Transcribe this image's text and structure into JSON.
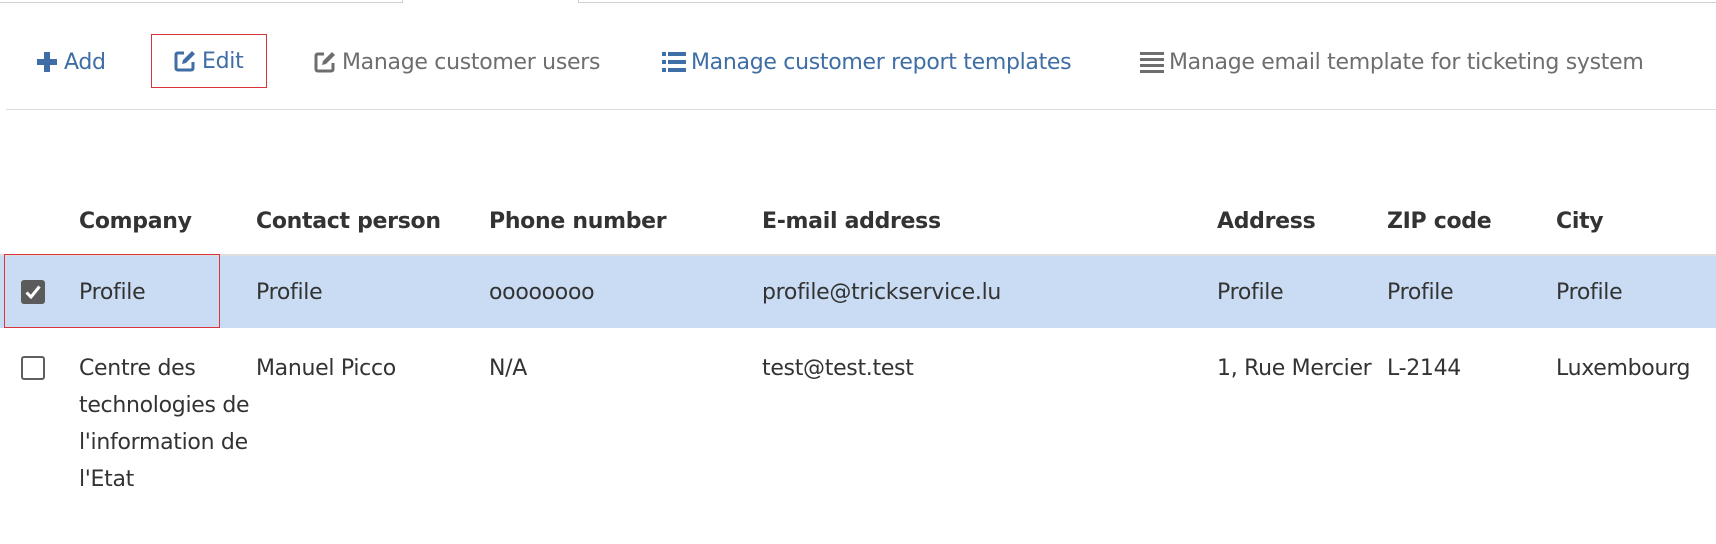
{
  "toolbar": {
    "add": {
      "label": "Add",
      "icon": "plus-icon"
    },
    "edit": {
      "label": "Edit",
      "icon": "edit-icon"
    },
    "manage_users": {
      "label": "Manage customer users",
      "icon": "edit-icon"
    },
    "manage_report_templates": {
      "label": "Manage customer report templates",
      "icon": "list-icon"
    },
    "manage_email_template": {
      "label": "Manage email template for ticketing system",
      "icon": "lines-icon"
    }
  },
  "colors": {
    "link_blue": "#3e6ea5",
    "gray_text": "#6e6e6e",
    "selected_row": "#c9dcf3",
    "highlight_outline": "#d9343a"
  },
  "table": {
    "headers": [
      "Company",
      "Contact person",
      "Phone number",
      "E-mail address",
      "Address",
      "ZIP code",
      "City"
    ],
    "rows": [
      {
        "selected": true,
        "company": "Profile",
        "contact": "Profile",
        "phone": "oooooooo",
        "email": "profile@trickservice.lu",
        "address": "Profile",
        "zip": "Profile",
        "city": "Profile"
      },
      {
        "selected": false,
        "company": "Centre des technologies de l'information de l'Etat",
        "contact": "Manuel Picco",
        "phone": "N/A",
        "email": "test@test.test",
        "address": "1, Rue Mercier",
        "zip": "L-2144",
        "city": "Luxembourg"
      }
    ]
  }
}
